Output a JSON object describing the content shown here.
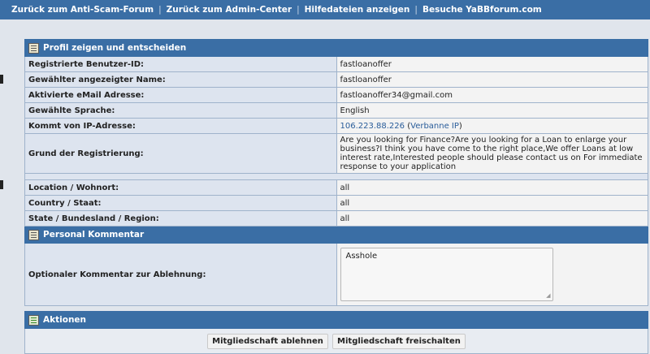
{
  "nav": {
    "items": [
      "Zurück zum Anti-Scam-Forum",
      "Zurück zum Admin-Center",
      "Hilfedateien anzeigen",
      "Besuche YaBBforum.com"
    ],
    "separator": "|"
  },
  "profile": {
    "title": "Profil zeigen und entscheiden",
    "rows": [
      {
        "label": "Registrierte Benutzer-ID:",
        "value": "fastloanoffer"
      },
      {
        "label": "Gewählter angezeigter Name:",
        "value": "fastloanoffer"
      },
      {
        "label": "Aktivierte eMail Adresse:",
        "value": "fastloanoffer34@gmail.com"
      },
      {
        "label": "Gewählte Sprache:",
        "value": "English"
      }
    ],
    "ip": {
      "label": "Kommt von IP-Adresse:",
      "address": "106.223.88.226",
      "ban_label": "Verbanne IP"
    },
    "reason": {
      "label": "Grund der Registrierung:",
      "value": "Are you looking for Finance?Are you looking for a Loan to enlarge your business?I think you have come to the right place,We offer Loans at low interest rate,Interested people should please contact us on For immediate response to your application"
    },
    "location_rows": [
      {
        "label": "Location / Wohnort:",
        "value": "all"
      },
      {
        "label": "Country / Staat:",
        "value": "all"
      },
      {
        "label": "State / Bundesland / Region:",
        "value": "all"
      }
    ]
  },
  "comment": {
    "title": "Personal Kommentar",
    "label": "Optionaler Kommentar zur Ablehnung:",
    "value": "Asshole"
  },
  "actions": {
    "title": "Aktionen",
    "reject_label": "Mitgliedschaft ablehnen",
    "approve_label": "Mitgliedschaft freischalten"
  },
  "colors": {
    "header_blue": "#3a6ea5",
    "label_bg": "#dde4ef",
    "page_bg": "#e0e5ec"
  }
}
